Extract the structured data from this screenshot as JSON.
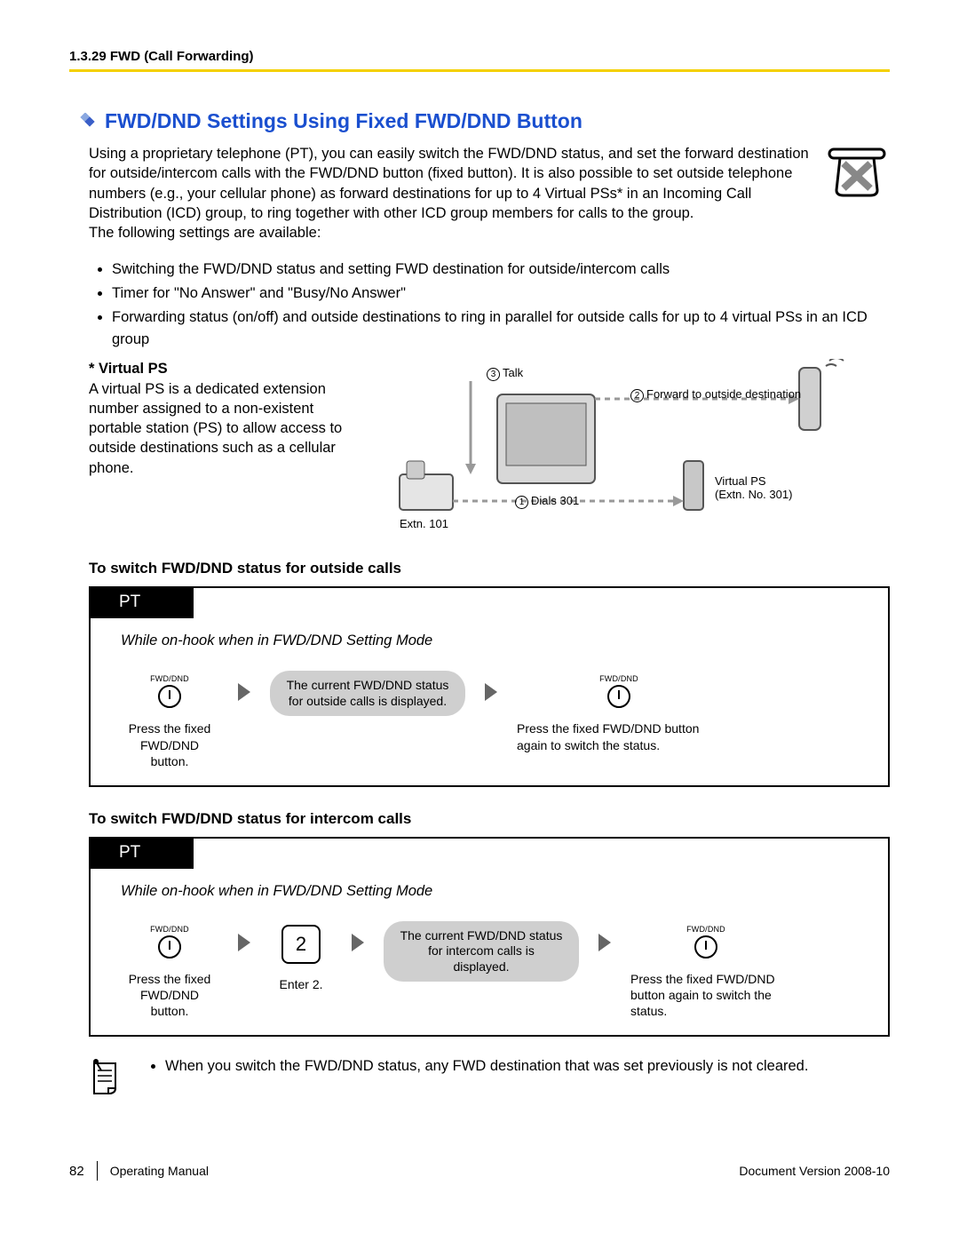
{
  "header": {
    "breadcrumb": "1.3.29 FWD (Call Forwarding)"
  },
  "section": {
    "title": "FWD/DND Settings Using Fixed FWD/DND Button",
    "intro_para": "Using a proprietary telephone (PT), you can easily switch the FWD/DND status, and set the forward destination for outside/intercom calls with the FWD/DND button (fixed button). It is also possible to set outside telephone numbers (e.g., your cellular phone) as forward destinations for up to 4 Virtual PSs* in an Incoming Call Distribution (ICD) group, to ring together with other ICD group members for calls to the group.",
    "intro_follow": "The following settings are available:",
    "bullets": [
      "Switching the FWD/DND status and setting FWD destination for outside/intercom calls",
      "Timer for \"No Answer\" and \"Busy/No Answer\"",
      "Forwarding status (on/off) and outside destinations to ring in parallel for outside calls for up to 4 virtual PSs in an ICD group"
    ],
    "vps": {
      "title": "* Virtual PS",
      "text": "A virtual PS is a dedicated extension number assigned to a non-existent portable station (PS) to allow access to outside destinations such as a cellular phone."
    },
    "diagram": {
      "talk": "Talk",
      "forward": "Forward to outside destination",
      "dials": "Dials 301",
      "extn101": "Extn. 101",
      "vps_label": "Virtual PS",
      "vps_ext": "(Extn. No. 301)",
      "n1": "1",
      "n2": "2",
      "n3": "3"
    }
  },
  "proc1": {
    "heading": "To switch FWD/DND status for outside calls",
    "tab": "PT",
    "mode": "While on-hook when in FWD/DND Setting Mode",
    "btn_label": "FWD/DND",
    "pill": "The current FWD/DND status for outside calls is displayed.",
    "cap_left": "Press the fixed FWD/DND button.",
    "cap_right": "Press the fixed FWD/DND button again to switch the status."
  },
  "proc2": {
    "heading": "To switch FWD/DND status for intercom calls",
    "tab": "PT",
    "mode": "While on-hook when in FWD/DND Setting Mode",
    "btn_label": "FWD/DND",
    "key": "2",
    "key_caption": "Enter 2.",
    "pill": "The current FWD/DND status for intercom calls is displayed.",
    "cap_left": "Press the fixed FWD/DND button.",
    "cap_right": "Press the fixed FWD/DND button again to switch the status."
  },
  "note": {
    "text": "When you switch the FWD/DND status, any FWD destination that was set previously is not cleared."
  },
  "footer": {
    "page": "82",
    "manual": "Operating Manual",
    "version": "Document Version  2008-10"
  }
}
